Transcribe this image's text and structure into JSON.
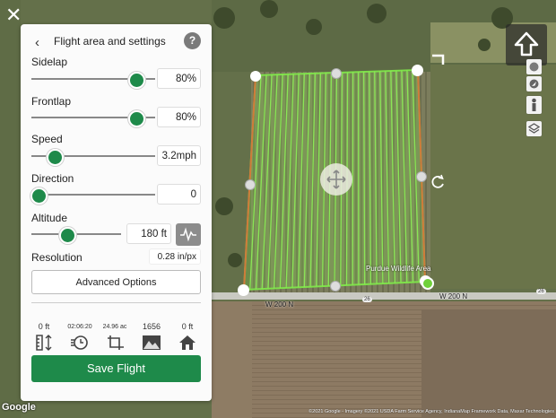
{
  "colors": {
    "accent": "#1e8a4a",
    "flight_path": "#7ee04a",
    "panel_bg": "#fbfbfb"
  },
  "panel": {
    "title": "Flight area and settings",
    "help_label": "?",
    "settings": [
      {
        "label": "Sidelap",
        "value": "80%",
        "level": 0.85
      },
      {
        "label": "Frontlap",
        "value": "80%",
        "level": 0.85
      },
      {
        "label": "Speed",
        "value": "3.2mph",
        "level": 0.19
      },
      {
        "label": "Direction",
        "value": "0",
        "level": 0.06
      },
      {
        "label": "Altitude",
        "value": "180 ft",
        "level": 0.4
      }
    ],
    "resolution_label": "Resolution",
    "resolution_value": "0.28 in/px",
    "advanced_label": "Advanced Options",
    "stats": [
      "0 ft",
      "02:06:20",
      "24.96 ac",
      "1656",
      "0 ft"
    ],
    "stat_icons": [
      "height-ruler-icon",
      "flight-time-icon",
      "area-icon",
      "photos-icon",
      "home-elevation-icon"
    ],
    "save_label": "Save Flight"
  },
  "map": {
    "road_labels": [
      "W 200 N",
      "W 200 N"
    ],
    "road_number": "26",
    "road_number_2": "26",
    "place_label": "Purdue Wildlife Area",
    "google_logo": "Google",
    "attribution": "©2021 Google - Imagery ©2021 USDA Farm Service Agency, IndianaMap Framework Data, Maxar Technologies"
  },
  "icons": [
    "close-icon",
    "back-chevron-icon",
    "help-icon",
    "waveform-icon",
    "home-arrow-icon",
    "globe-icon",
    "compass-icon",
    "person-icon",
    "layers-icon",
    "move-icon",
    "rotate-icon"
  ]
}
